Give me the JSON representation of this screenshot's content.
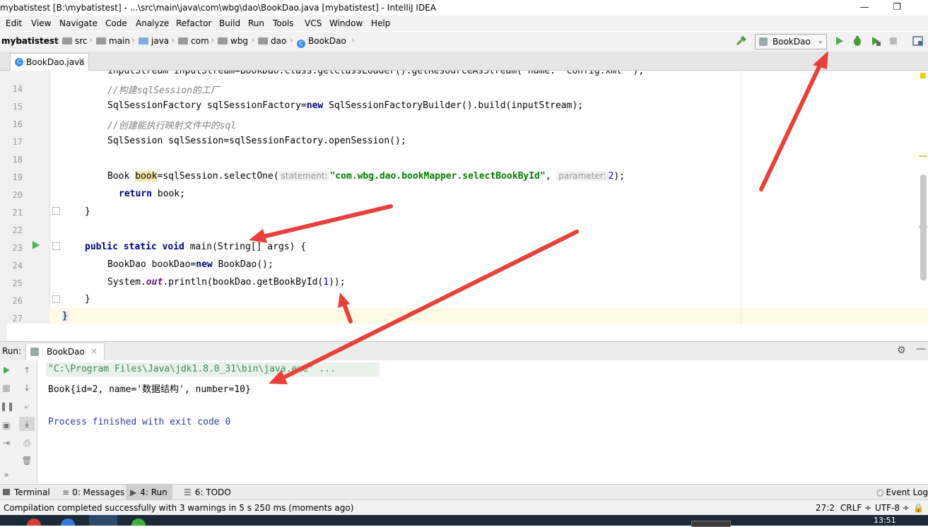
{
  "window": {
    "title": "mybatistest [B:\\mybatistest] - ...\\src\\main\\java\\com\\wbg\\dao\\BookDao.java [mybatistest] - IntelliJ IDEA",
    "min_glyph": "—",
    "max_glyph": "❐",
    "close_glyph": "✕"
  },
  "menu": [
    "Edit",
    "View",
    "Navigate",
    "Code",
    "Analyze",
    "Refactor",
    "Build",
    "Run",
    "Tools",
    "VCS",
    "Window",
    "Help"
  ],
  "breadcrumbs": {
    "project": "mybatistest",
    "items": [
      "src",
      "main",
      "java",
      "com",
      "wbg",
      "dao",
      "BookDao"
    ]
  },
  "run_config": {
    "selected": "BookDao"
  },
  "tab": {
    "label": "BookDao.java",
    "close": "×"
  },
  "editor": {
    "partial_line": "inputStream inputStream=BookDao.class.getClassLoader().getResourceAsStream( name: \"config.xml\" );",
    "line_numbers": [
      "14",
      "15",
      "16",
      "17",
      "18",
      "19",
      "20",
      "21",
      "22",
      "23",
      "24",
      "25",
      "26",
      "27"
    ],
    "lines": {
      "l14": "//构建sqlSession的工厂",
      "l15a": "SqlSessionFactory sqlSessionFactory=",
      "l15kw": "new",
      "l15b": " SqlSessionFactoryBuilder().build(inputStream);",
      "l16": "//创建能执行映射文件中的sql",
      "l17": "SqlSession sqlSession=sqlSessionFactory.openSession();",
      "l19a": "Book ",
      "l19var": "book",
      "l19b": "=sqlSession.selectOne(",
      "l19hint1": "statement:",
      "l19str": "\"com.wbg.dao.bookMapper.selectBookById\"",
      "l19comma": ", ",
      "l19hint2": "parameter:",
      "l19num": "2",
      "l19end": ");",
      "l20kw": "return",
      "l20b": " book;",
      "l21": "}",
      "l23kw": "public static void",
      "l23b": " main(String[] args) {",
      "l24a": "BookDao bookDao=",
      "l24kw": "new",
      "l24b": " BookDao();",
      "l25a": "System.",
      "l25fld": "out",
      "l25b": ".println(bookDao.getBookById(",
      "l25num": "1",
      "l25end": "));",
      "l26": "}",
      "l27": "}"
    }
  },
  "run_panel": {
    "label": "Run:",
    "tab": "BookDao",
    "tab_close": "×",
    "console": {
      "cmd": "\"C:\\Program Files\\Java\\jdk1.8.0_31\\bin\\java.exe\" ...",
      "output": "Book{id=2, name='数据结构', number=10}",
      "exit": "Process finished with exit code 0"
    }
  },
  "tool_windows": [
    "Terminal",
    "0: Messages",
    "4: Run",
    "6: TODO"
  ],
  "event_log": "Event Log",
  "status": {
    "message": "Compilation completed successfully with 3 warnings in 5 s 250 ms (moments ago)",
    "position": "27:2",
    "line_sep": "CRLF ÷",
    "encoding": "UTF-8 ÷"
  },
  "taskbar": {
    "time": "13:51"
  },
  "colors": {
    "arrow": "#e8403a",
    "run_green": "#4caf50",
    "keyword": "#000080",
    "string": "#008000",
    "comment": "#808080"
  }
}
